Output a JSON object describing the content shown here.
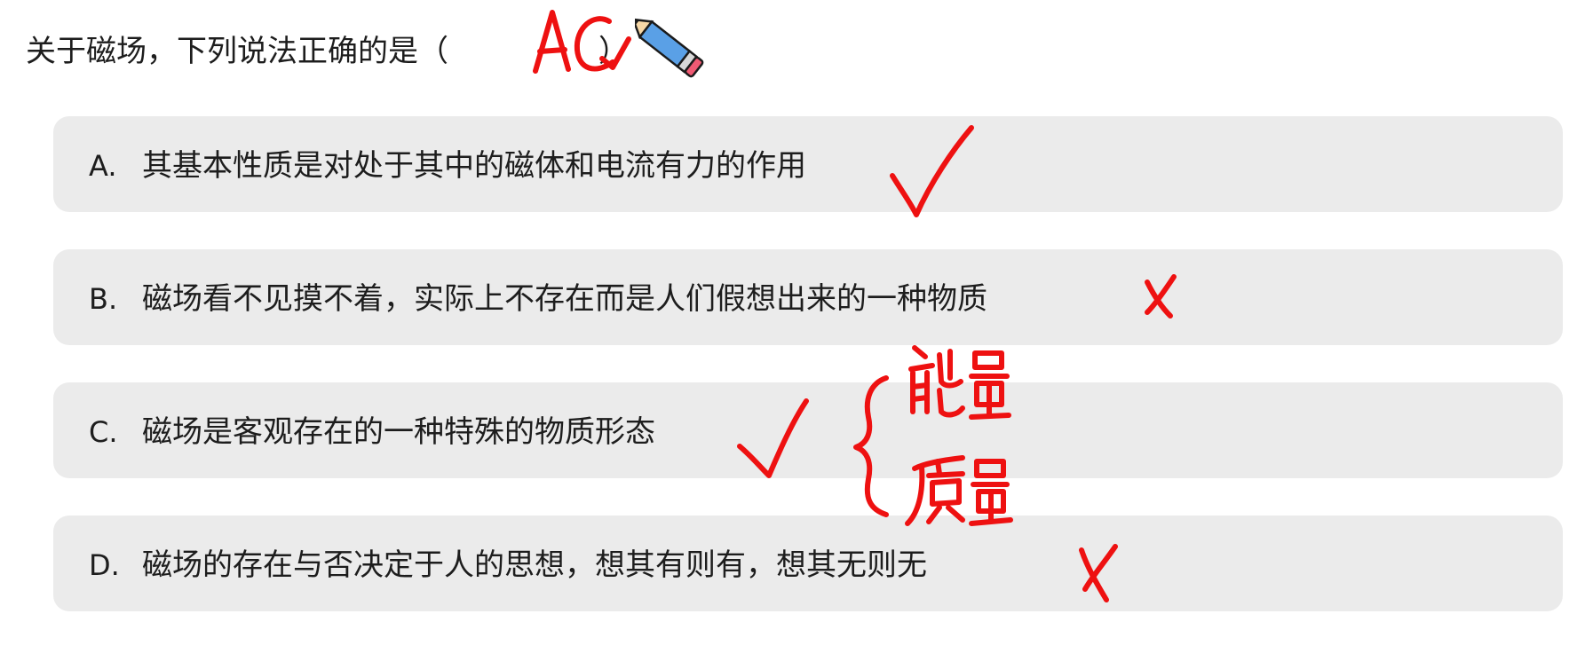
{
  "question": {
    "text": "关于磁场，下列说法正确的是",
    "paren_open": "（",
    "paren_close": "）",
    "handwritten_answer": "AC"
  },
  "options": [
    {
      "letter": "A.",
      "text": "其基本性质是对处于其中的磁体和电流有力的作用",
      "mark": "✓"
    },
    {
      "letter": "B.",
      "text": "磁场看不见摸不着，实际上不存在而是人们假想出来的一种物质",
      "mark": "✗"
    },
    {
      "letter": "C.",
      "text": "磁场是客观存在的一种特殊的物质形态",
      "mark": "✓"
    },
    {
      "letter": "D.",
      "text": "磁场的存在与否决定于人的思想，想其有则有，想其无则无",
      "mark": "✗"
    }
  ],
  "annotation": {
    "notes": [
      "能量",
      "质量"
    ]
  },
  "colors": {
    "ink": "#ee1111",
    "option_bg": "#ebebeb",
    "text": "#1d1d1d"
  },
  "icons": [
    "pencil-icon"
  ]
}
